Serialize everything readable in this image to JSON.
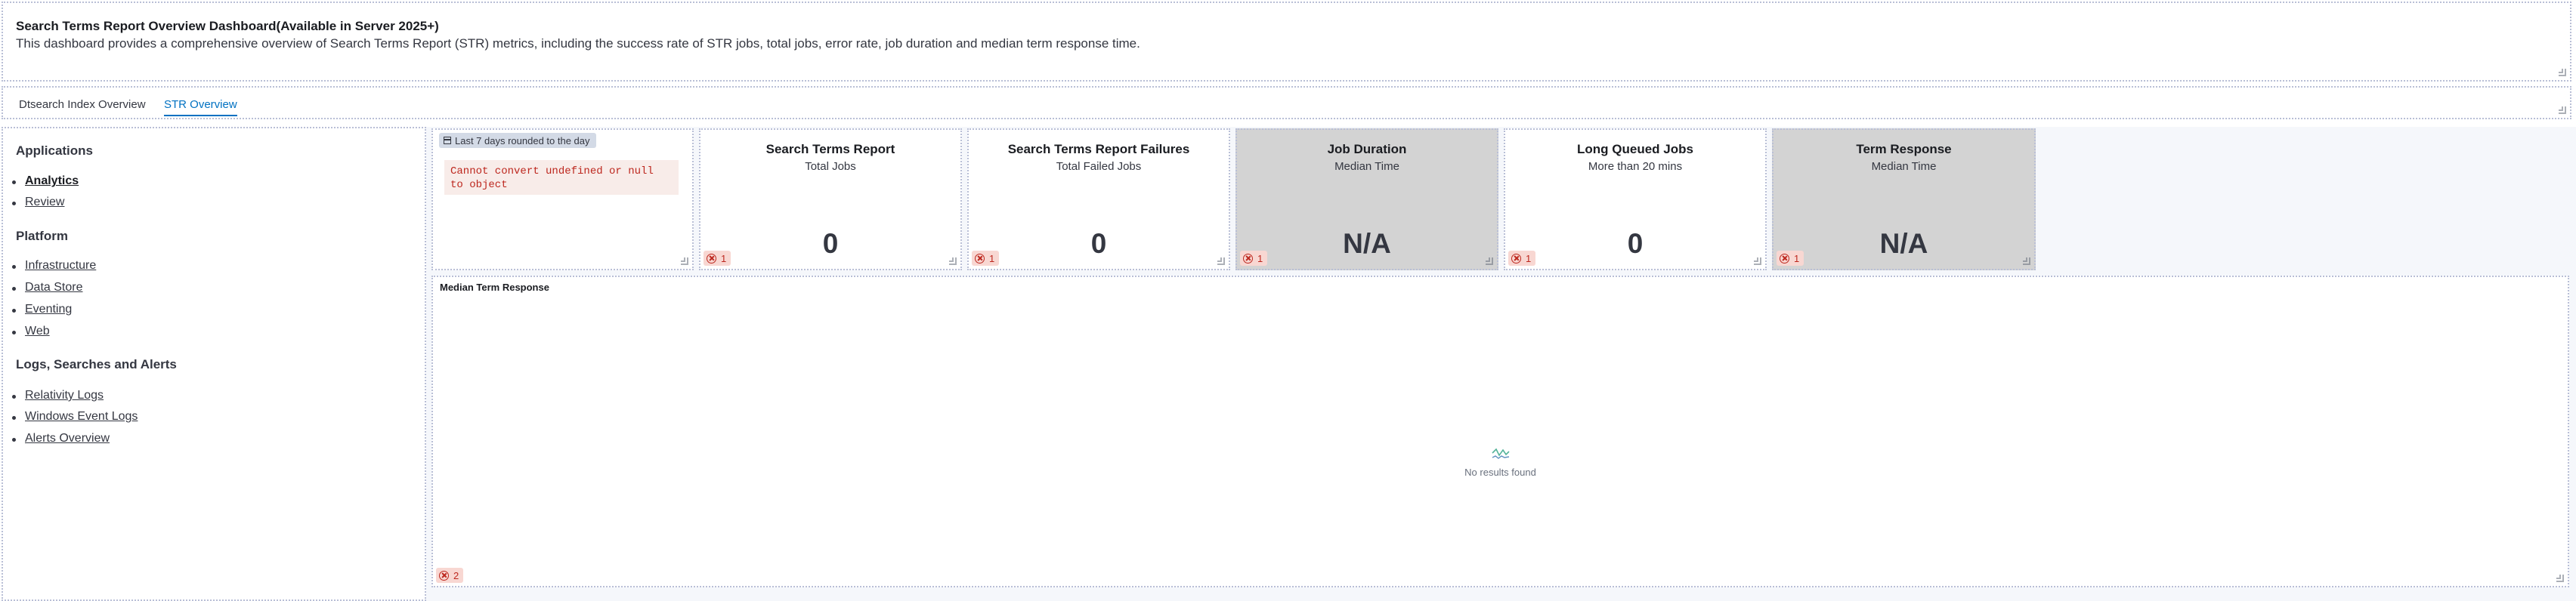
{
  "header": {
    "title": "Search Terms Report Overview Dashboard(Available in Server 2025+)",
    "description": "This dashboard provides a comprehensive overview of Search Terms Report (STR) metrics, including the success rate of STR jobs, total jobs, error rate, job duration and median term response time."
  },
  "tabs": [
    {
      "label": "Dtsearch Index Overview",
      "active": false
    },
    {
      "label": "STR Overview",
      "active": true
    }
  ],
  "nav": {
    "sections": [
      {
        "heading": "Applications",
        "items": [
          "Analytics",
          "Review"
        ]
      },
      {
        "heading": "Platform",
        "items": [
          "Infrastructure",
          "Data Store",
          "Eventing",
          "Web"
        ]
      },
      {
        "heading": "Logs, Searches and Alerts",
        "items": [
          "Relativity Logs",
          "Windows Event Logs",
          "Alerts Overview"
        ]
      }
    ],
    "current": "Analytics"
  },
  "time_panel": {
    "badge": "Last 7 days rounded to the day",
    "error": "Cannot convert undefined or null to object"
  },
  "cards": [
    {
      "title": "Search Terms Report",
      "subtitle": "Total Jobs",
      "value": "0",
      "errors": "1",
      "grey": false
    },
    {
      "title": "Search Terms Report Failures",
      "subtitle": "Total Failed Jobs",
      "value": "0",
      "errors": "1",
      "grey": false
    },
    {
      "title": "Job Duration",
      "subtitle": "Median Time",
      "value": "N/A",
      "errors": "1",
      "grey": true
    },
    {
      "title": "Long Queued Jobs",
      "subtitle": "More than 20 mins",
      "value": "0",
      "errors": "1",
      "grey": false
    },
    {
      "title": "Term Response",
      "subtitle": "Median Time",
      "value": "N/A",
      "errors": "1",
      "grey": true
    }
  ],
  "median_panel": {
    "title": "Median Term Response",
    "empty_message": "No results found",
    "errors": "2"
  },
  "colors": {
    "accent": "#0071c2",
    "error": "#bd271e",
    "error_bg": "#f8d7d2",
    "grey_card": "#d3d3d3",
    "empty_icon": "#54b399"
  },
  "icons": [
    "calendar-icon",
    "error-icon",
    "chart-empty-icon",
    "resize-handle-icon"
  ]
}
